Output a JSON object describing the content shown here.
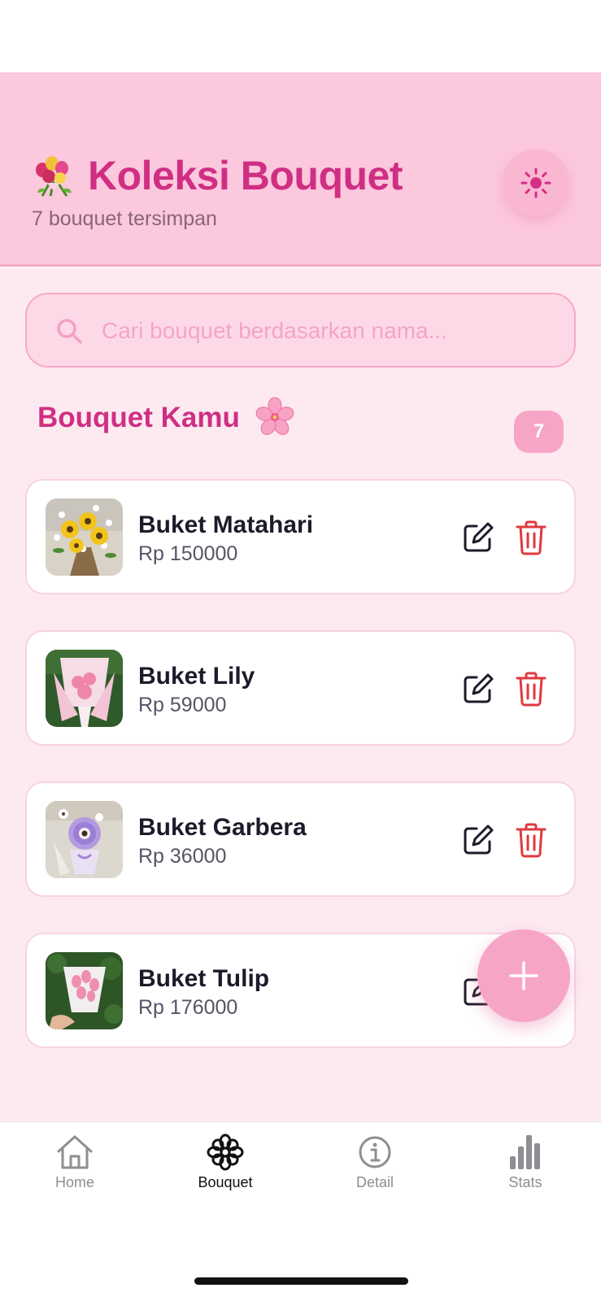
{
  "header": {
    "emoji_icon": "bouquet-emoji-icon",
    "title": "Koleksi Bouquet",
    "subtitle": "7 bouquet tersimpan",
    "theme_toggle_icon": "sun-icon",
    "background_color": "#fcc8de",
    "title_color": "#cf2f83"
  },
  "search": {
    "placeholder": "Cari bouquet berdasarkan nama...",
    "value": ""
  },
  "section": {
    "title": "Bouquet Kamu",
    "emoji_icon": "cherry-blossom-emoji-icon",
    "count": "7"
  },
  "bouquets": [
    {
      "name": "Buket Matahari",
      "price": "Rp 150000",
      "image": "sunflower-bouquet-photo"
    },
    {
      "name": "Buket Lily",
      "price": "Rp 59000",
      "image": "pink-lily-bouquet-photo"
    },
    {
      "name": "Buket Garbera",
      "price": "Rp 36000",
      "image": "purple-gerbera-bouquet-photo"
    },
    {
      "name": "Buket Tulip",
      "price": "Rp 176000",
      "image": "pink-tulip-bouquet-photo"
    }
  ],
  "fab": {
    "icon": "plus-icon"
  },
  "nav": {
    "items": [
      {
        "label": "Home",
        "icon": "home-icon",
        "active": false
      },
      {
        "label": "Bouquet",
        "icon": "flower-icon",
        "active": true
      },
      {
        "label": "Detail",
        "icon": "info-icon",
        "active": false
      },
      {
        "label": "Stats",
        "icon": "bar-chart-icon",
        "active": false
      }
    ]
  },
  "colors": {
    "accent": "#cf2f83",
    "pink_light": "#fdeaf1",
    "badge": "#f7a5c6",
    "delete": "#e0393e"
  }
}
